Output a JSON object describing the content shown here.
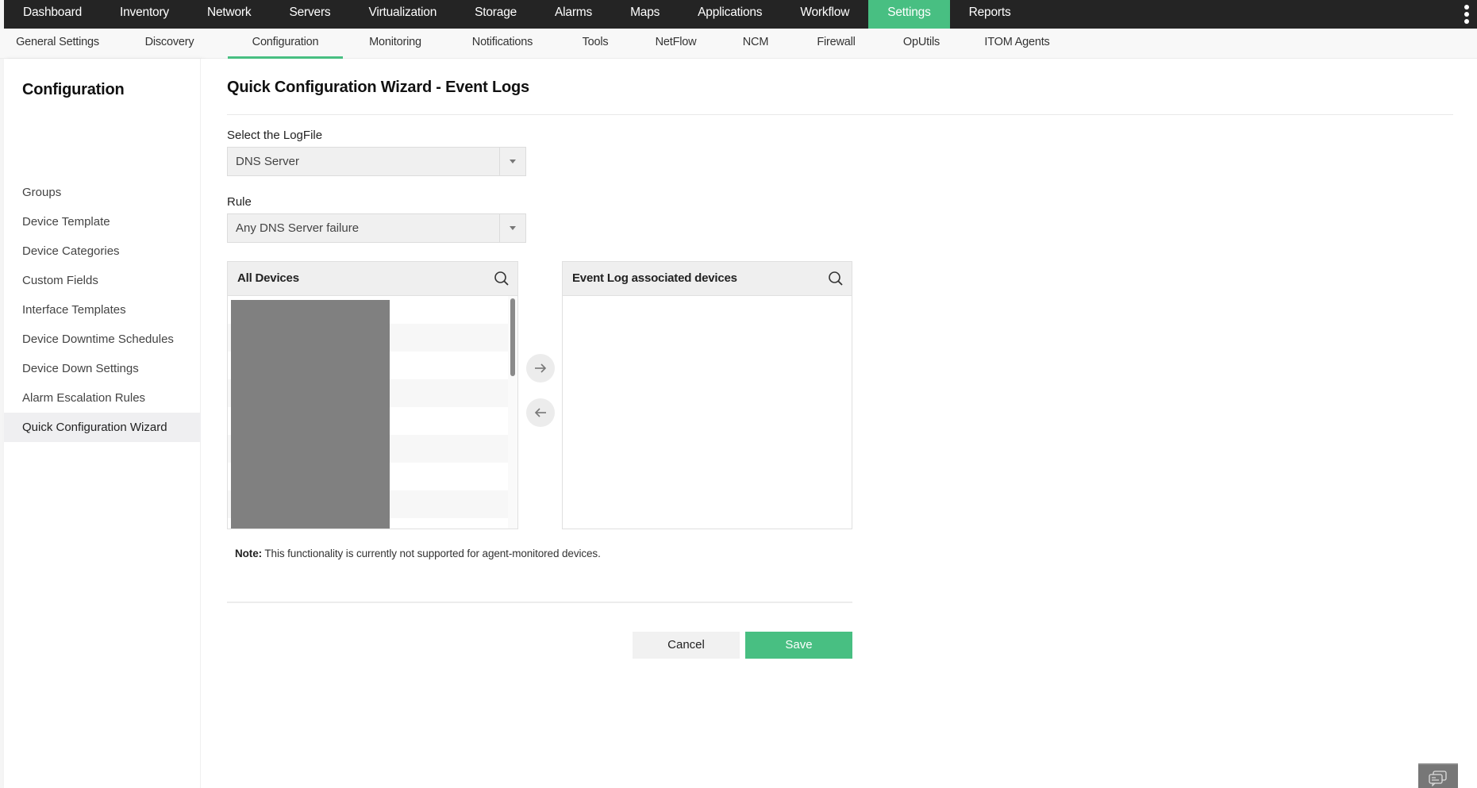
{
  "top_nav": {
    "items": [
      {
        "label": "Dashboard",
        "active": false
      },
      {
        "label": "Inventory",
        "active": false
      },
      {
        "label": "Network",
        "active": false
      },
      {
        "label": "Servers",
        "active": false
      },
      {
        "label": "Virtualization",
        "active": false
      },
      {
        "label": "Storage",
        "active": false
      },
      {
        "label": "Alarms",
        "active": false
      },
      {
        "label": "Maps",
        "active": false
      },
      {
        "label": "Applications",
        "active": false
      },
      {
        "label": "Workflow",
        "active": false
      },
      {
        "label": "Settings",
        "active": true
      },
      {
        "label": "Reports",
        "active": false
      }
    ],
    "more_icon": "kebab-menu-icon"
  },
  "sub_nav": {
    "items": [
      {
        "label": "General Settings",
        "active": false
      },
      {
        "label": "Discovery",
        "active": false
      },
      {
        "label": "Configuration",
        "active": true
      },
      {
        "label": "Monitoring",
        "active": false
      },
      {
        "label": "Notifications",
        "active": false
      },
      {
        "label": "Tools",
        "active": false
      },
      {
        "label": "NetFlow",
        "active": false
      },
      {
        "label": "NCM",
        "active": false
      },
      {
        "label": "Firewall",
        "active": false
      },
      {
        "label": "OpUtils",
        "active": false
      },
      {
        "label": "ITOM Agents",
        "active": false
      }
    ]
  },
  "sidebar": {
    "title": "Configuration",
    "items": [
      {
        "label": "Groups",
        "active": false
      },
      {
        "label": "Device Template",
        "active": false
      },
      {
        "label": "Device Categories",
        "active": false
      },
      {
        "label": "Custom Fields",
        "active": false
      },
      {
        "label": "Interface Templates",
        "active": false
      },
      {
        "label": "Device Downtime Schedules",
        "active": false
      },
      {
        "label": "Device Down Settings",
        "active": false
      },
      {
        "label": "Alarm Escalation Rules",
        "active": false
      },
      {
        "label": "Quick Configuration Wizard",
        "active": true
      }
    ]
  },
  "main": {
    "title": "Quick Configuration Wizard - Event Logs",
    "logfile": {
      "label": "Select the LogFile",
      "value": "DNS Server"
    },
    "rule": {
      "label": "Rule",
      "value": "Any DNS Server failure"
    },
    "all_devices": {
      "title": "All Devices",
      "search_icon": "search-icon",
      "rows_visible": 8,
      "content": "redacted"
    },
    "associated_devices": {
      "title": "Event Log associated devices",
      "search_icon": "search-icon",
      "rows": []
    },
    "move_right_icon": "arrow-right-icon",
    "move_left_icon": "arrow-left-icon",
    "note": {
      "prefix": "Note:",
      "text": " This functionality is currently not supported for agent-monitored devices."
    },
    "buttons": {
      "cancel": "Cancel",
      "save": "Save"
    }
  },
  "colors": {
    "accent": "#48bf82",
    "top_bar": "#242424"
  },
  "chat_widget_icon": "chat-icon"
}
